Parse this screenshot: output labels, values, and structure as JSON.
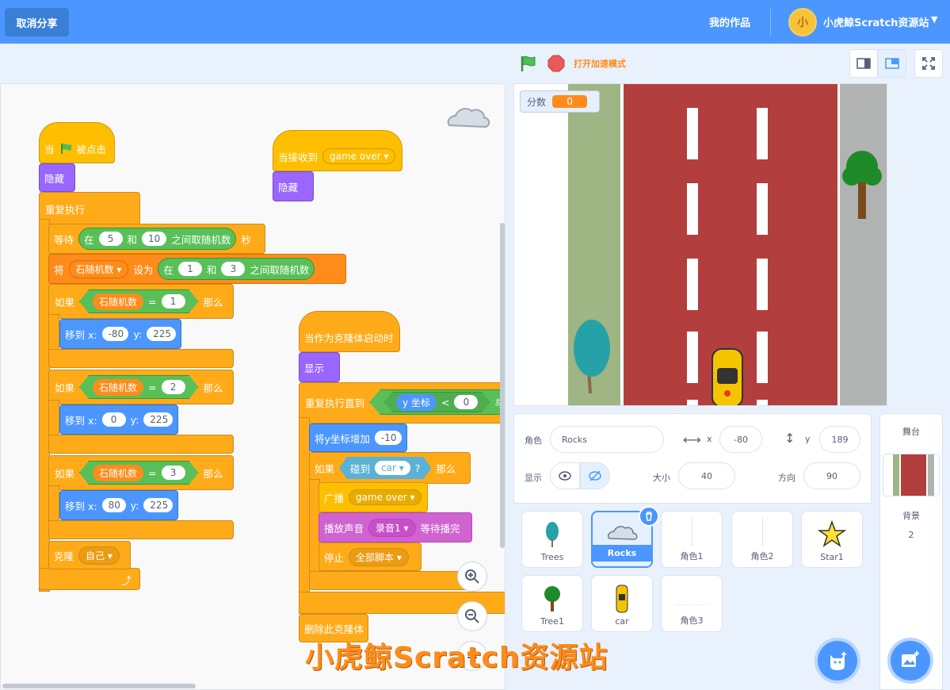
{
  "topbar": {
    "cancel_share": "取消分享",
    "my_works": "我的作品",
    "user": "小虎鲸Scratch资源站",
    "avatar_text": "小"
  },
  "controls": {
    "turbo": "打开加速模式"
  },
  "scripts": {
    "s1_hat_when": "当",
    "s1_hat_clicked": "被点击",
    "s1_hide": "隐藏",
    "s1_forever": "重复执行",
    "wait_label": "等待",
    "wait_in": "在",
    "wait_a": "5",
    "wait_and": "和",
    "wait_b": "10",
    "wait_rand": "之间取随机数",
    "wait_sec": "秒",
    "set_label": "将",
    "set_var": "石随机数",
    "set_to": "设为",
    "set_in": "在",
    "set_a": "1",
    "set_and": "和",
    "set_b": "3",
    "set_rand": "之间取随机数",
    "if_label": "如果",
    "then_label": "那么",
    "var": "石随机数",
    "eq": "=",
    "if1_val": "1",
    "if2_val": "2",
    "if3_val": "3",
    "goto_label": "移到 x:",
    "goto_y": "y:",
    "g1_x": "-80",
    "g1_y": "225",
    "g2_x": "0",
    "g2_y": "225",
    "g3_x": "80",
    "g3_y": "225",
    "clone_label": "克隆",
    "clone_target": "自己",
    "s2_hat": "当接收到",
    "s2_msg": "game over",
    "s2_hide": "隐藏",
    "s3_hat": "当作为克隆体启动时",
    "s3_show": "显示",
    "s3_repeat": "重复执行直到",
    "s3_ycoord": "y 坐标",
    "s3_lt": "<",
    "s3_zero": "0",
    "s3_and": "与",
    "s3_change": "将y坐标增加",
    "s3_change_val": "-10",
    "s3_if": "如果",
    "s3_touch": "碰到",
    "s3_touch_target": "car",
    "s3_q": "?",
    "s3_then": "那么",
    "s3_broadcast": "广播",
    "s3_broadcast_msg": "game over",
    "s3_play": "播放声音",
    "s3_sound": "录音1",
    "s3_until": "等待播完",
    "s3_stop": "停止",
    "s3_stop_opt": "全部脚本",
    "s3_delete": "删除此克隆体"
  },
  "stage": {
    "monitor_label": "分数",
    "monitor_value": "0"
  },
  "sprite_info": {
    "sprite_label": "角色",
    "sprite_name": "Rocks",
    "x_label": "x",
    "x_val": "-80",
    "y_label": "y",
    "y_val": "189",
    "show_label": "显示",
    "size_label": "大小",
    "size_val": "40",
    "dir_label": "方向",
    "dir_val": "90"
  },
  "sprites": [
    "Trees",
    "Rocks",
    "角色1",
    "角色2",
    "Star1",
    "Tree1",
    "car",
    "角色3"
  ],
  "backdrop": {
    "title": "舞台",
    "label": "背景",
    "count": "2"
  },
  "watermark": "小虎鲸Scratch资源站",
  "colors": {
    "topbar": "#4c97ff",
    "control": "#ffab19",
    "event": "#ffbf00",
    "looks": "#9966ff",
    "operator": "#59c059",
    "motion": "#4c97ff",
    "sound": "#cf63cf",
    "variable": "#ff8c1a"
  }
}
